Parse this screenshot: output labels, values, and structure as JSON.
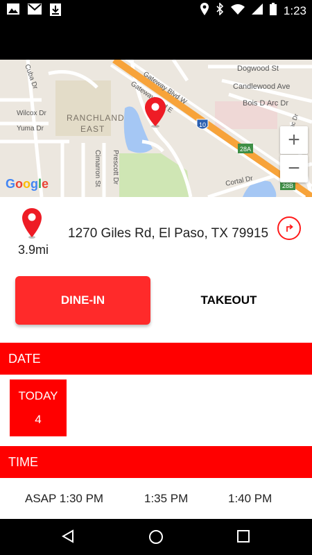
{
  "status_bar": {
    "time": "1:23",
    "left_icons": [
      "gallery-icon",
      "gmail-icon",
      "download-icon"
    ],
    "right_icons": [
      "location-icon",
      "bluetooth-icon",
      "wifi-icon",
      "signal-icon",
      "battery-icon"
    ]
  },
  "map": {
    "labels": {
      "gateway_blvd_w": "Gateway Blvd W",
      "gateway_blvd_e": "Gateway Blvd E",
      "dogwood": "Dogwood St",
      "candlewood": "Candlewood Ave",
      "bois_d_arc": "Bois D Arc Dr",
      "cuba": "Cuba Dr",
      "wilcox": "Wilcox Dr",
      "yuma": "Yuma Dr",
      "ranchland": "RANCHLAND",
      "east": "EAST",
      "cimarron": "Cimarron St",
      "prescott": "Prescott Dr",
      "cortal": "Cortal Dr",
      "lilac": "Lilac Dr",
      "shield_10": "10",
      "exit_28a": "28A",
      "exit_28b": "28B"
    },
    "zoom_in": "+",
    "zoom_out": "−",
    "google": [
      "G",
      "o",
      "o",
      "g",
      "l",
      "e"
    ]
  },
  "location": {
    "distance": "3.9mi",
    "address": "1270 Giles Rd, El Paso, TX 79915"
  },
  "order_type": {
    "dine_in": "DINE-IN",
    "takeout": "TAKEOUT"
  },
  "date_section": {
    "header": "DATE",
    "selected": {
      "line1": "TODAY",
      "line2": "4"
    }
  },
  "time_section": {
    "header": "TIME",
    "options": [
      "ASAP 1:30 PM",
      "1:35 PM",
      "1:40 PM"
    ]
  },
  "colors": {
    "accent": "#ff0000",
    "button": "#ff2a2a"
  }
}
